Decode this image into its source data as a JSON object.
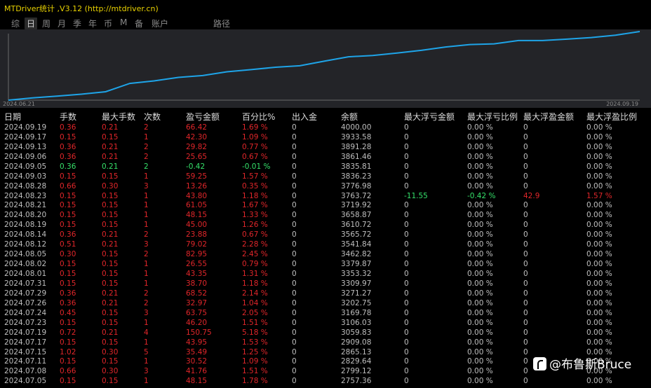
{
  "window": {
    "title": "MTDriver统计 ,V3.12 (http://mtdriver.cn)"
  },
  "menu": {
    "items": [
      "综",
      "日",
      "周",
      "月",
      "季",
      "年",
      "币",
      "M",
      "备",
      "账户",
      "路径"
    ],
    "active": "日"
  },
  "chart": {
    "start_date": "2024.06.21",
    "end_date": "2024.09.19",
    "line_color": "#1ea4e8",
    "balance_series": [
      2757.36,
      2799.12,
      2829.64,
      2865.13,
      2909.08,
      3059.83,
      3106.03,
      3169.78,
      3202.75,
      3271.27,
      3309.97,
      3353.32,
      3379.87,
      3462.82,
      3541.84,
      3565.72,
      3610.72,
      3658.87,
      3719.92,
      3763.72,
      3776.98,
      3836.23,
      3835.81,
      3861.46,
      3891.28,
      3933.58,
      4000.0
    ]
  },
  "table": {
    "headers": [
      "日期",
      "手数",
      "最大手数",
      "次数",
      "盈亏金额",
      "百分比%",
      "出入金",
      "余额",
      "最大浮亏金额",
      "最大浮亏比例",
      "最大浮盈金额",
      "最大浮盈比例"
    ],
    "rows": [
      [
        "2024.09.19",
        "0.36",
        "0.21",
        "2",
        "66.42",
        "1.69 %",
        "0",
        "4000.00",
        "0",
        "0.00 %",
        "0",
        "0.00 %"
      ],
      [
        "2024.09.17",
        "0.15",
        "0.15",
        "1",
        "42.30",
        "1.09 %",
        "0",
        "3933.58",
        "0",
        "0.00 %",
        "0",
        "0.00 %"
      ],
      [
        "2024.09.13",
        "0.36",
        "0.21",
        "2",
        "29.82",
        "0.77 %",
        "0",
        "3891.28",
        "0",
        "0.00 %",
        "0",
        "0.00 %"
      ],
      [
        "2024.09.06",
        "0.36",
        "0.21",
        "2",
        "25.65",
        "0.67 %",
        "0",
        "3861.46",
        "0",
        "0.00 %",
        "0",
        "0.00 %"
      ],
      [
        "2024.09.05",
        "0.36",
        "0.21",
        "2",
        "-0.42",
        "-0.01 %",
        "0",
        "3835.81",
        "0",
        "0.00 %",
        "0",
        "0.00 %"
      ],
      [
        "2024.09.03",
        "0.15",
        "0.15",
        "1",
        "59.25",
        "1.57 %",
        "0",
        "3836.23",
        "0",
        "0.00 %",
        "0",
        "0.00 %"
      ],
      [
        "2024.08.28",
        "0.66",
        "0.30",
        "3",
        "13.26",
        "0.35 %",
        "0",
        "3776.98",
        "0",
        "0.00 %",
        "0",
        "0.00 %"
      ],
      [
        "2024.08.23",
        "0.15",
        "0.15",
        "1",
        "43.80",
        "1.18 %",
        "0",
        "3763.72",
        "-11.55",
        "-0.42 %",
        "42.9",
        "1.57 %"
      ],
      [
        "2024.08.21",
        "0.15",
        "0.15",
        "1",
        "61.05",
        "1.67 %",
        "0",
        "3719.92",
        "0",
        "0.00 %",
        "0",
        "0.00 %"
      ],
      [
        "2024.08.20",
        "0.15",
        "0.15",
        "1",
        "48.15",
        "1.33 %",
        "0",
        "3658.87",
        "0",
        "0.00 %",
        "0",
        "0.00 %"
      ],
      [
        "2024.08.19",
        "0.15",
        "0.15",
        "1",
        "45.00",
        "1.26 %",
        "0",
        "3610.72",
        "0",
        "0.00 %",
        "0",
        "0.00 %"
      ],
      [
        "2024.08.14",
        "0.36",
        "0.21",
        "2",
        "23.88",
        "0.67 %",
        "0",
        "3565.72",
        "0",
        "0.00 %",
        "0",
        "0.00 %"
      ],
      [
        "2024.08.12",
        "0.51",
        "0.21",
        "3",
        "79.02",
        "2.28 %",
        "0",
        "3541.84",
        "0",
        "0.00 %",
        "0",
        "0.00 %"
      ],
      [
        "2024.08.05",
        "0.30",
        "0.15",
        "2",
        "82.95",
        "2.45 %",
        "0",
        "3462.82",
        "0",
        "0.00 %",
        "0",
        "0.00 %"
      ],
      [
        "2024.08.02",
        "0.15",
        "0.15",
        "1",
        "26.55",
        "0.79 %",
        "0",
        "3379.87",
        "0",
        "0.00 %",
        "0",
        "0.00 %"
      ],
      [
        "2024.08.01",
        "0.15",
        "0.15",
        "1",
        "43.35",
        "1.31 %",
        "0",
        "3353.32",
        "0",
        "0.00 %",
        "0",
        "0.00 %"
      ],
      [
        "2024.07.31",
        "0.15",
        "0.15",
        "1",
        "38.70",
        "1.18 %",
        "0",
        "3309.97",
        "0",
        "0.00 %",
        "0",
        "0.00 %"
      ],
      [
        "2024.07.29",
        "0.36",
        "0.21",
        "2",
        "68.52",
        "2.14 %",
        "0",
        "3271.27",
        "0",
        "0.00 %",
        "0",
        "0.00 %"
      ],
      [
        "2024.07.26",
        "0.36",
        "0.21",
        "2",
        "32.97",
        "1.04 %",
        "0",
        "3202.75",
        "0",
        "0.00 %",
        "0",
        "0.00 %"
      ],
      [
        "2024.07.24",
        "0.45",
        "0.15",
        "3",
        "63.75",
        "2.05 %",
        "0",
        "3169.78",
        "0",
        "0.00 %",
        "0",
        "0.00 %"
      ],
      [
        "2024.07.23",
        "0.15",
        "0.15",
        "1",
        "46.20",
        "1.51 %",
        "0",
        "3106.03",
        "0",
        "0.00 %",
        "0",
        "0.00 %"
      ],
      [
        "2024.07.19",
        "0.72",
        "0.21",
        "4",
        "150.75",
        "5.18 %",
        "0",
        "3059.83",
        "0",
        "0.00 %",
        "0",
        "0.00 %"
      ],
      [
        "2024.07.17",
        "0.15",
        "0.15",
        "1",
        "43.95",
        "1.53 %",
        "0",
        "2909.08",
        "0",
        "0.00 %",
        "0",
        "0.00 %"
      ],
      [
        "2024.07.15",
        "1.02",
        "0.30",
        "5",
        "35.49",
        "1.25 %",
        "0",
        "2865.13",
        "0",
        "0.00 %",
        "0",
        "0.00 %"
      ],
      [
        "2024.07.11",
        "0.15",
        "0.15",
        "1",
        "30.52",
        "1.09 %",
        "0",
        "2829.64",
        "0",
        "0.00 %",
        "0",
        "0.00 %"
      ],
      [
        "2024.07.08",
        "0.66",
        "0.30",
        "3",
        "41.76",
        "1.51 %",
        "0",
        "2799.12",
        "0",
        "0.00 %",
        "0",
        "0.00 %"
      ],
      [
        "2024.07.05",
        "0.15",
        "0.15",
        "1",
        "48.15",
        "1.78 %",
        "0",
        "2757.36",
        "0",
        "0.00 %",
        "0",
        "0.00 %"
      ]
    ]
  },
  "watermark": {
    "text": "@布鲁斯Bruce"
  }
}
